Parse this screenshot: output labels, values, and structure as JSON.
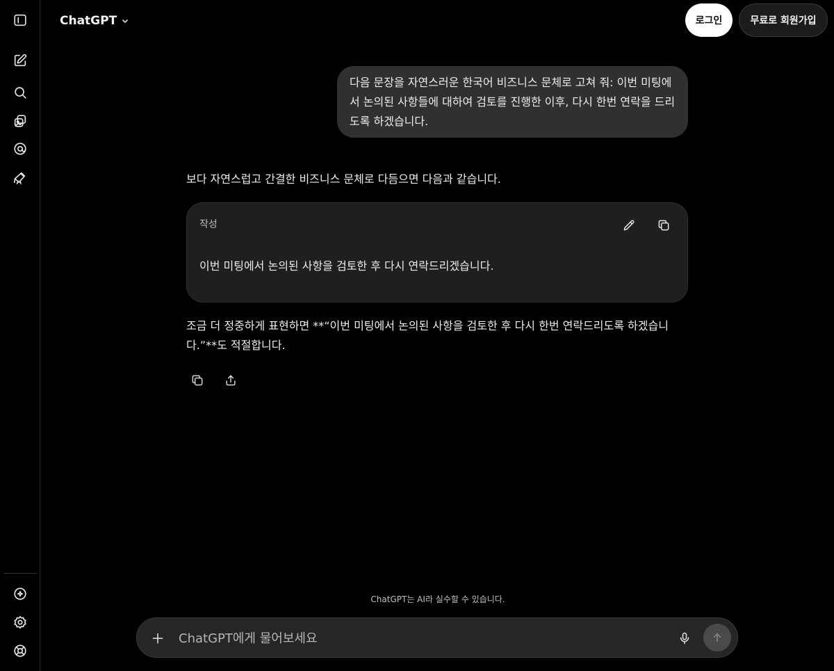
{
  "header": {
    "model_name": "ChatGPT",
    "login_label": "로그인",
    "signup_label": "무료로 회원가입"
  },
  "conversation": {
    "user_message": "다음 문장을 자연스러운 한국어 비즈니스 문체로 고쳐 줘: 이번 미팅에서 논의된 사항들에 대하여 검토를 진행한 이후, 다시 한번 연락을 드리도록 하겠습니다.",
    "assistant_intro": "보다 자연스럽고 간결한 비즈니스 문체로 다듬으면 다음과 같습니다.",
    "canvas_label": "작성",
    "canvas_text": "이번 미팅에서 논의된 사항을 검토한 후 다시 연락드리겠습니다.",
    "assistant_followup": "조금 더 정중하게 표현하면 **“이번 미팅에서 논의된 사항을 검토한 후 다시 한번 연락드리도록 하겠습니다.”**도 적절합니다."
  },
  "footer": {
    "disclaimer": "ChatGPT는 AI라 실수할 수 있습니다.",
    "composer_placeholder": "ChatGPT에게 물어보세요"
  },
  "icons": {
    "sidebar": [
      "sidebar-toggle-icon",
      "new-chat-icon",
      "search-icon",
      "library-icon",
      "sora-icon",
      "gpts-icon"
    ],
    "sidebar_bottom": [
      "upgrade-icon",
      "settings-icon",
      "help-icon"
    ],
    "canvas_tools": [
      "edit-icon",
      "copy-icon"
    ],
    "message_actions": [
      "copy-icon",
      "share-icon"
    ],
    "composer": [
      "plus-icon",
      "mic-icon",
      "send-arrow-icon"
    ]
  },
  "colors": {
    "background": "#000000",
    "user_bubble": "#303030",
    "canvas_card": "#1f1f1f",
    "composer": "#262626",
    "login_button": "#ffffff",
    "send_button": "#4a4a4a"
  }
}
